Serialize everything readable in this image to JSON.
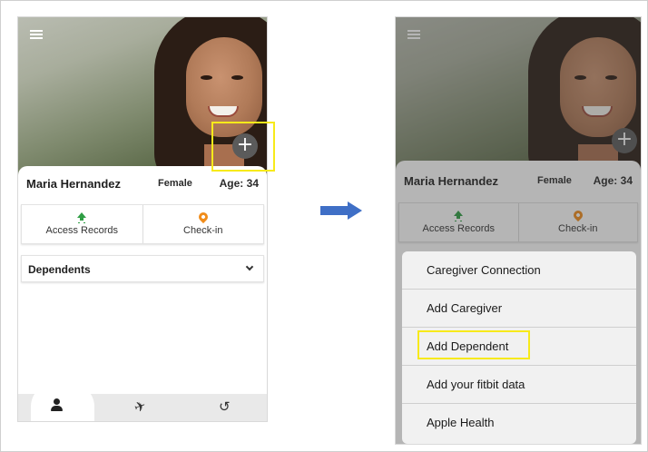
{
  "left_screen": {
    "profile": {
      "name": "Maria Hernandez",
      "gender": "Female",
      "age": "Age: 34"
    },
    "plus_button": "+",
    "actions": {
      "access_records": "Access Records",
      "check_in": "Check-in"
    },
    "dependents_label": "Dependents",
    "tabbar": {
      "icons": [
        "user-icon",
        "send-icon",
        "history-icon"
      ],
      "send_glyph": "✈",
      "history_glyph": "↺"
    }
  },
  "right_screen": {
    "profile": {
      "name": "Maria Hernandez",
      "gender": "Female",
      "age": "Age: 34"
    },
    "plus_button": "+",
    "actions": {
      "access_records": "Access Records",
      "check_in": "Check-in"
    },
    "menu_options": [
      "Caregiver Connection",
      "Add Caregiver",
      "Add Dependent",
      "Add your fitbit data",
      "Apple Health"
    ]
  },
  "colors": {
    "highlight": "#f7ea1a",
    "arrow": "#3f6fc6",
    "upload_icon": "#2f9e44",
    "pin_icon": "#f08c1a"
  }
}
